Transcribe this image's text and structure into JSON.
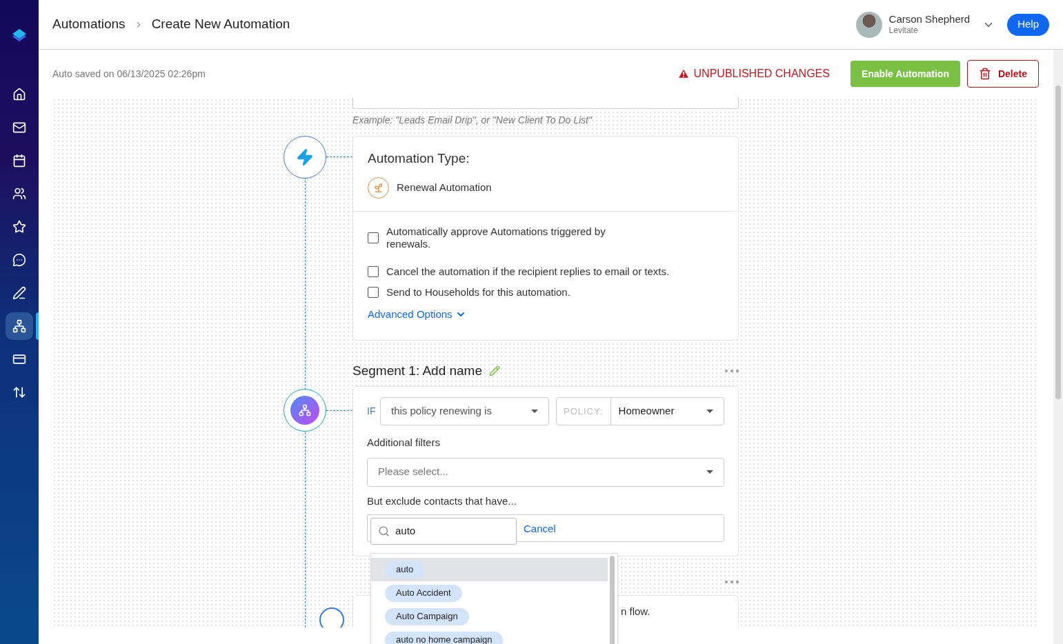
{
  "breadcrumb": [
    {
      "label": "Automations"
    },
    {
      "label": "Create New Automation"
    }
  ],
  "user": {
    "name": "Carson Shepherd",
    "org": "Levitate"
  },
  "help_button": "Help",
  "sidebar": {
    "items": [
      {
        "selected": false
      },
      {
        "selected": false
      },
      {
        "selected": false
      },
      {
        "selected": false
      },
      {
        "selected": false
      },
      {
        "selected": false
      },
      {
        "selected": false
      },
      {
        "selected": true
      },
      {
        "selected": false
      },
      {
        "selected": false
      }
    ]
  },
  "autosave": "Auto saved on 06/13/2025 02:26pm",
  "status": "UNPUBLISHED CHANGES",
  "actions": {
    "enable": "Enable Automation",
    "delete": "Delete"
  },
  "name_field": {
    "hint": "Example: \"Leads Email Drip\", or \"New Client To Do List\""
  },
  "type_card": {
    "title": "Automation Type:",
    "type": "Renewal Automation",
    "options": [
      {
        "label": "Automatically approve Automations triggered by renewals.",
        "checked": false
      },
      {
        "label": "Cancel the automation if the recipient replies to email or texts.",
        "checked": false
      },
      {
        "label": "Send to Households for this automation.",
        "checked": false
      }
    ],
    "advanced": "Advanced Options"
  },
  "segment": {
    "title": "Segment 1: Add name",
    "if": "IF",
    "condition": "this policy renewing is",
    "policy_label": "POLICY:",
    "policy": "Homeowner",
    "filters_label": "Additional filters",
    "filters_placeholder": "Please select...",
    "exclude_label": "But exclude contacts that have...",
    "search_value": "auto",
    "cancel": "Cancel",
    "suggestions": [
      {
        "label": "auto",
        "selected": true
      },
      {
        "label": "Auto Accident",
        "selected": false
      },
      {
        "label": "Auto Campaign",
        "selected": false
      },
      {
        "label": "auto no home campaign",
        "selected": false
      }
    ]
  },
  "next_step": {
    "text_end": "n flow."
  }
}
